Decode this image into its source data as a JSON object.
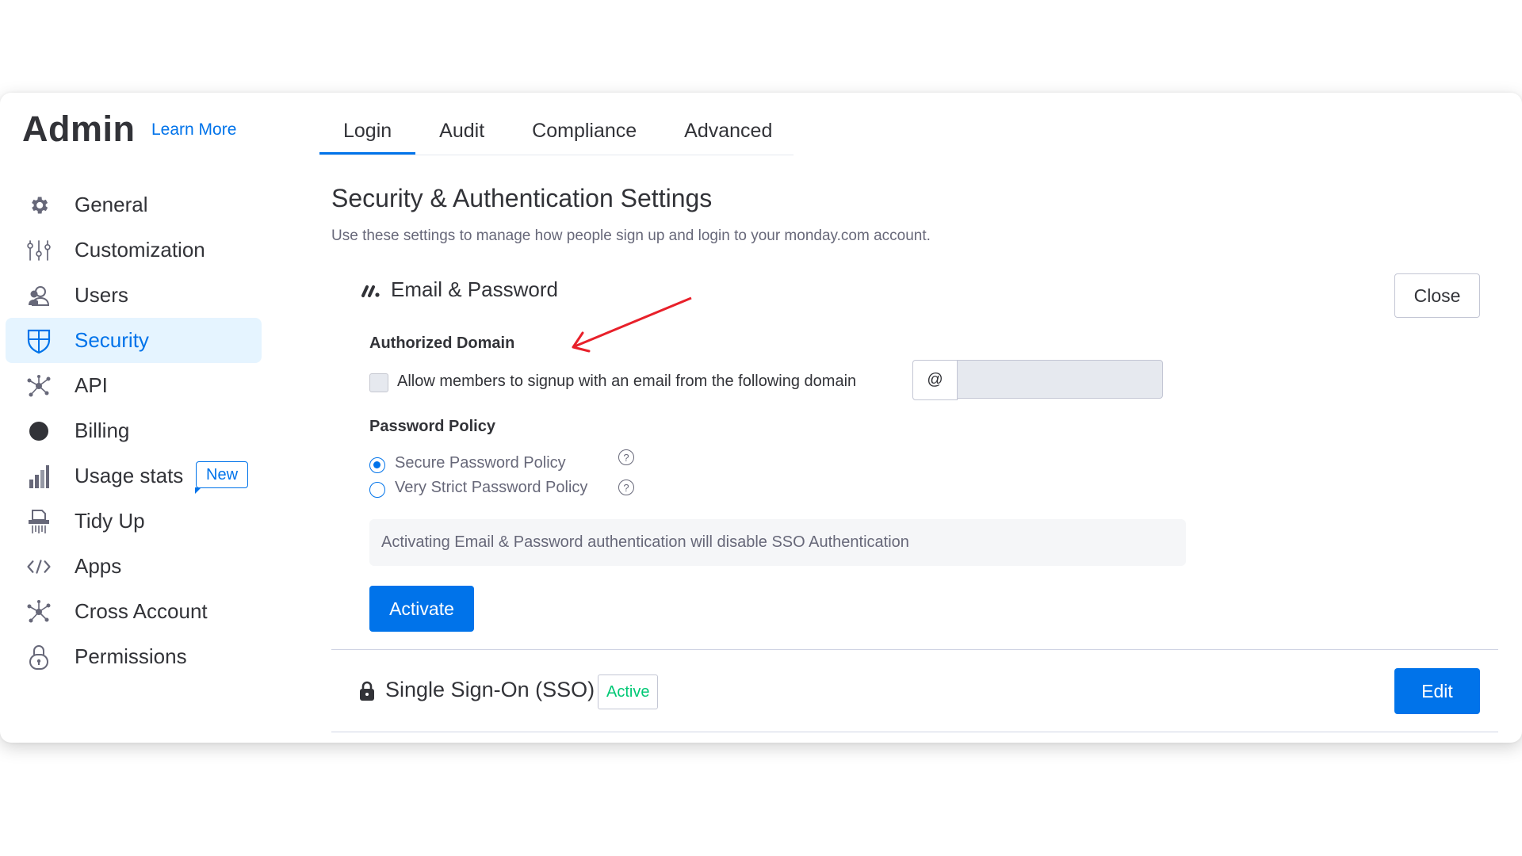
{
  "header": {
    "title": "Admin",
    "learn_more": "Learn More"
  },
  "sidebar": {
    "items": [
      {
        "label": "General",
        "icon": "gear-icon"
      },
      {
        "label": "Customization",
        "icon": "sliders-icon"
      },
      {
        "label": "Users",
        "icon": "users-icon"
      },
      {
        "label": "Security",
        "icon": "shield-icon",
        "active": true
      },
      {
        "label": "API",
        "icon": "api-nodes-icon"
      },
      {
        "label": "Billing",
        "icon": "billing-circle-icon"
      },
      {
        "label": "Usage stats",
        "icon": "bar-chart-icon",
        "badge": "New"
      },
      {
        "label": "Tidy Up",
        "icon": "shredder-icon"
      },
      {
        "label": "Apps",
        "icon": "code-icon"
      },
      {
        "label": "Cross Account",
        "icon": "network-icon"
      },
      {
        "label": "Permissions",
        "icon": "padlock-icon"
      }
    ]
  },
  "tabs": [
    {
      "label": "Login",
      "active": true
    },
    {
      "label": "Audit"
    },
    {
      "label": "Compliance"
    },
    {
      "label": "Advanced"
    }
  ],
  "main": {
    "title": "Security & Authentication Settings",
    "subtitle": "Use these settings to manage how people sign up and login to your monday.com account.",
    "email_section": {
      "title": "Email & Password",
      "close_label": "Close",
      "authorized_domain_heading": "Authorized Domain",
      "checkbox_label": "Allow members to signup with an email from the following domain",
      "checkbox_checked": false,
      "at_symbol": "@",
      "domain_value": "",
      "password_policy_heading": "Password Policy",
      "policies": [
        {
          "label": "Secure Password Policy",
          "selected": true
        },
        {
          "label": "Very Strict Password Policy",
          "selected": false
        }
      ],
      "help_glyph": "?",
      "notice": "Activating Email & Password authentication will disable SSO Authentication",
      "activate_label": "Activate"
    },
    "sso_section": {
      "title": "Single Sign-On (SSO)",
      "status": "Active",
      "edit_label": "Edit"
    }
  },
  "colors": {
    "accent": "#0073ea",
    "active_status": "#00c875",
    "sidebar_active_bg": "#e5f4ff",
    "annotation_arrow": "#e8202a"
  }
}
